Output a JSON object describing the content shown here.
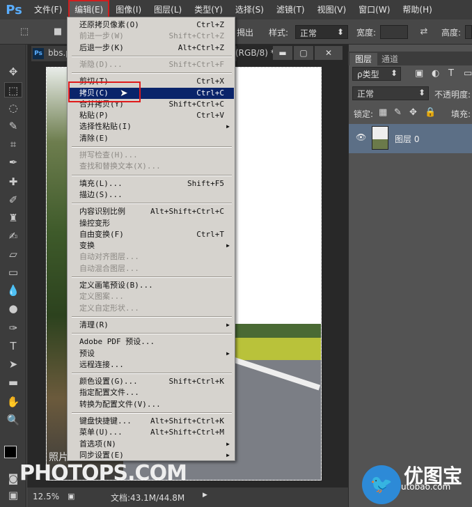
{
  "menubar": {
    "logo": "Ps",
    "items": [
      "文件(F)",
      "编辑(E)",
      "图像(I)",
      "图层(L)",
      "类型(Y)",
      "选择(S)",
      "滤镜(T)",
      "视图(V)",
      "窗口(W)",
      "帮助(H)"
    ]
  },
  "options": {
    "partial_text": "揭出",
    "style_label": "样式:",
    "style_value": "正常",
    "width_label": "宽度:",
    "height_label": "高度:"
  },
  "document": {
    "tab": "bbs.ps",
    "mode": "(RGB/8) *"
  },
  "edit_menu": [
    {
      "label": "还原拷贝像素(O)",
      "shortcut": "Ctrl+Z",
      "disabled": false
    },
    {
      "label": "前进一步(W)",
      "shortcut": "Shift+Ctrl+Z",
      "disabled": true
    },
    {
      "label": "后退一步(K)",
      "shortcut": "Alt+Ctrl+Z",
      "disabled": false
    },
    {
      "sep": true
    },
    {
      "label": "渐隐(D)...",
      "shortcut": "Shift+Ctrl+F",
      "disabled": true
    },
    {
      "sep": true
    },
    {
      "label": "剪切(T)",
      "shortcut": "Ctrl+X",
      "disabled": false
    },
    {
      "label": "拷贝(C)",
      "shortcut": "Ctrl+C",
      "disabled": false,
      "highlight": true
    },
    {
      "label": "合并拷贝(Y)",
      "shortcut": "Shift+Ctrl+C",
      "disabled": false
    },
    {
      "label": "粘贴(P)",
      "shortcut": "Ctrl+V",
      "disabled": false
    },
    {
      "label": "选择性粘贴(I)",
      "shortcut": "",
      "submenu": true,
      "disabled": false
    },
    {
      "label": "清除(E)",
      "shortcut": "",
      "disabled": false
    },
    {
      "sep": true
    },
    {
      "label": "拼写检查(H)...",
      "shortcut": "",
      "disabled": true
    },
    {
      "label": "查找和替换文本(X)...",
      "shortcut": "",
      "disabled": true
    },
    {
      "sep": true
    },
    {
      "label": "填充(L)...",
      "shortcut": "Shift+F5",
      "disabled": false
    },
    {
      "label": "描边(S)...",
      "shortcut": "",
      "disabled": false
    },
    {
      "sep": true
    },
    {
      "label": "内容识别比例",
      "shortcut": "Alt+Shift+Ctrl+C",
      "disabled": false
    },
    {
      "label": "操控变形",
      "shortcut": "",
      "disabled": false
    },
    {
      "label": "自由变换(F)",
      "shortcut": "Ctrl+T",
      "disabled": false
    },
    {
      "label": "变换",
      "shortcut": "",
      "submenu": true,
      "disabled": false
    },
    {
      "label": "自动对齐图层...",
      "shortcut": "",
      "disabled": true
    },
    {
      "label": "自动混合图层...",
      "shortcut": "",
      "disabled": true
    },
    {
      "sep": true
    },
    {
      "label": "定义画笔预设(B)...",
      "shortcut": "",
      "disabled": false
    },
    {
      "label": "定义图案...",
      "shortcut": "",
      "disabled": true
    },
    {
      "label": "定义自定形状...",
      "shortcut": "",
      "disabled": true
    },
    {
      "sep": true
    },
    {
      "label": "清理(R)",
      "shortcut": "",
      "submenu": true,
      "disabled": false
    },
    {
      "sep": true
    },
    {
      "label": "Adobe PDF 预设...",
      "shortcut": "",
      "disabled": false
    },
    {
      "label": "预设",
      "shortcut": "",
      "submenu": true,
      "disabled": false
    },
    {
      "label": "远程连接...",
      "shortcut": "",
      "disabled": false
    },
    {
      "sep": true
    },
    {
      "label": "颜色设置(G)...",
      "shortcut": "Shift+Ctrl+K",
      "disabled": false
    },
    {
      "label": "指定配置文件...",
      "shortcut": "",
      "disabled": false
    },
    {
      "label": "转换为配置文件(V)...",
      "shortcut": "",
      "disabled": false
    },
    {
      "sep": true
    },
    {
      "label": "键盘快捷键...",
      "shortcut": "Alt+Shift+Ctrl+K",
      "disabled": false
    },
    {
      "label": "菜单(U)...",
      "shortcut": "Alt+Shift+Ctrl+M",
      "disabled": false
    },
    {
      "label": "首选项(N)",
      "shortcut": "",
      "submenu": true,
      "disabled": false
    },
    {
      "label": "同步设置(E)",
      "shortcut": "",
      "submenu": true,
      "disabled": false
    }
  ],
  "panel": {
    "tabs": [
      "图层",
      "通道"
    ],
    "kind": "ρ类型",
    "blend": "正常",
    "opacity_label": "不透明度:",
    "lock_label": "锁定:",
    "fill_label": "填充:",
    "layer_name": "图层 0"
  },
  "status": {
    "zoom": "12.5%",
    "doc": "文档:43.1M/44.8M"
  },
  "watermarks": {
    "left_small": "照片处理网",
    "left_big": "PHOTOPS.COM",
    "right_big": "优图宝",
    "right_small": "utobao.com"
  }
}
